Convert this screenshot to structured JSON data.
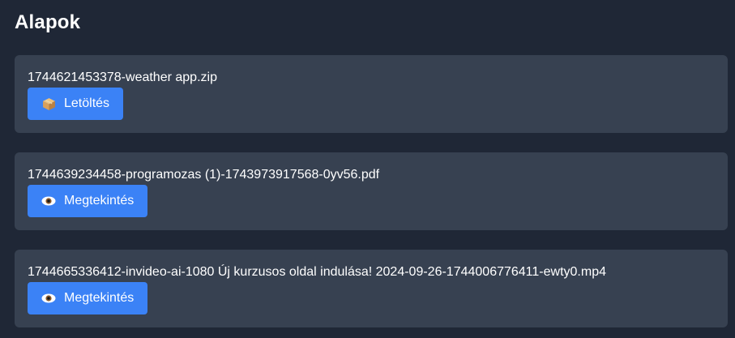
{
  "section": {
    "title": "Alapok"
  },
  "files": [
    {
      "name": "1744621453378-weather app.zip",
      "button_label": "Letöltés",
      "button_icon": "package-icon"
    },
    {
      "name": "1744639234458-programozas (1)-1743973917568-0yv56.pdf",
      "button_label": "Megtekintés",
      "button_icon": "eye-icon"
    },
    {
      "name": "1744665336412-invideo-ai-1080 Új kurzusos oldal indulása! 2024-09-26-1744006776411-ewty0.mp4",
      "button_label": "Megtekintés",
      "button_icon": "eye-icon"
    }
  ],
  "colors": {
    "background": "#1f2736",
    "card": "#374151",
    "button": "#3b82f6"
  }
}
